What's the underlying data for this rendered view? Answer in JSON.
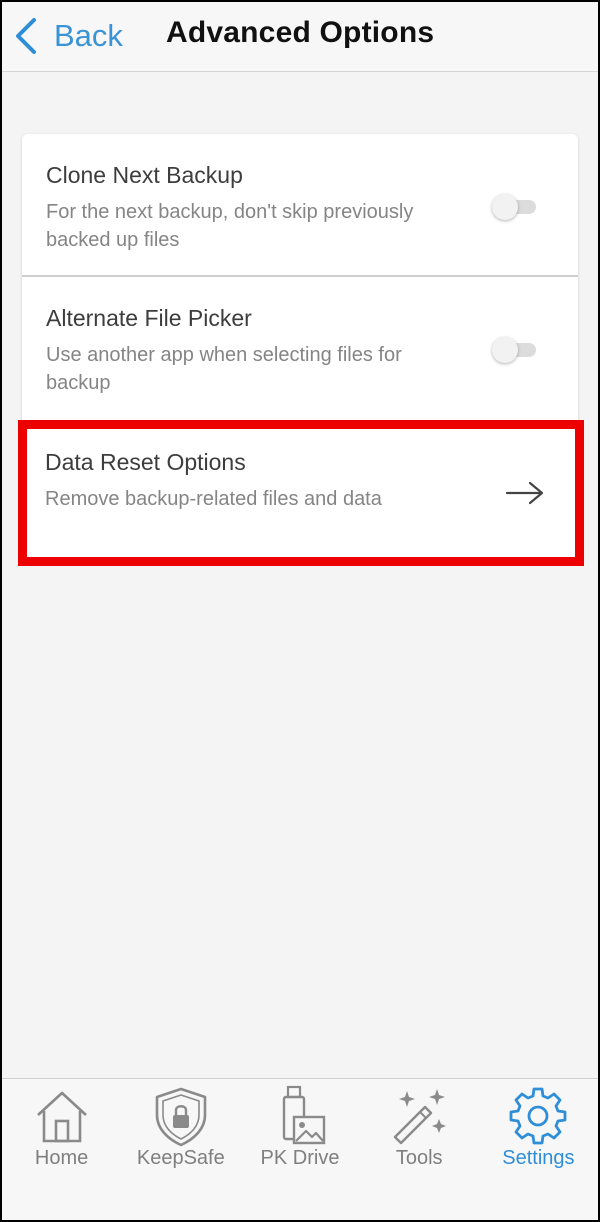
{
  "header": {
    "back_label": "Back",
    "title": "Advanced Options"
  },
  "options": [
    {
      "title": "Clone Next Backup",
      "subtitle": "For the next backup, don't skip previously backed up files",
      "control": "toggle",
      "enabled": false
    },
    {
      "title": "Alternate File Picker",
      "subtitle": "Use another app when selecting files for backup",
      "control": "toggle",
      "enabled": false
    },
    {
      "title": "Data Reset Options",
      "subtitle": "Remove backup-related files and data",
      "control": "arrow-right-icon",
      "highlighted": true
    }
  ],
  "tabs": [
    {
      "label": "Home",
      "icon": "home-icon",
      "active": false
    },
    {
      "label": "KeepSafe",
      "icon": "shield-lock-icon",
      "active": false
    },
    {
      "label": "PK Drive",
      "icon": "drive-icon",
      "active": false
    },
    {
      "label": "Tools",
      "icon": "magic-wand-icon",
      "active": false
    },
    {
      "label": "Settings",
      "icon": "gear-icon",
      "active": true
    }
  ],
  "colors": {
    "accent": "#2f8ed8",
    "highlight": "#ec0000",
    "background": "#f4f4f4"
  }
}
